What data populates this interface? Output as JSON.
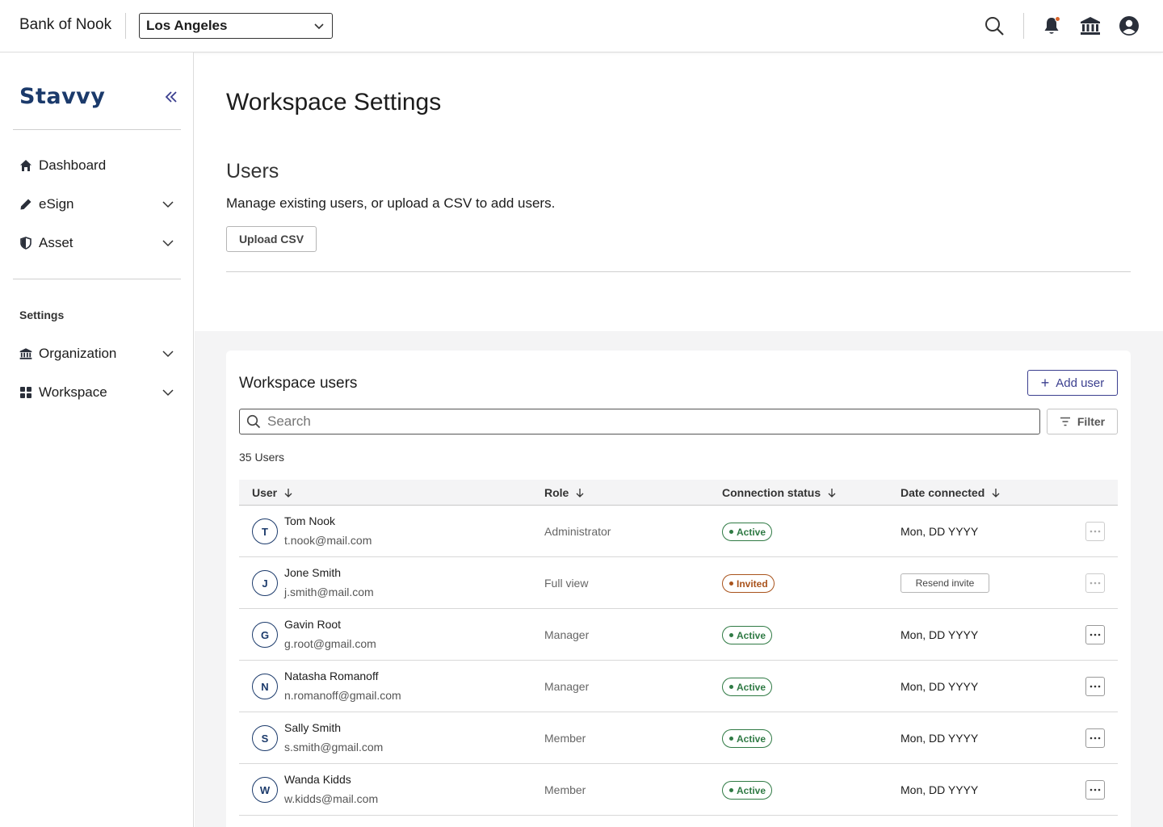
{
  "topbar": {
    "org_name": "Bank of Nook",
    "location": "Los Angeles",
    "icons": [
      "search-icon",
      "bell-icon",
      "bank-icon",
      "account-icon"
    ]
  },
  "sidebar": {
    "brand": "Stavvy",
    "items": [
      {
        "label": "Dashboard",
        "icon": "home-icon"
      },
      {
        "label": "eSign",
        "icon": "pen-icon"
      },
      {
        "label": "Asset",
        "icon": "shield-icon"
      }
    ],
    "settings_label": "Settings",
    "settings_items": [
      {
        "label": "Organization",
        "icon": "bank-icon"
      },
      {
        "label": "Workspace",
        "icon": "grid-icon"
      }
    ]
  },
  "main": {
    "page_title": "Workspace Settings",
    "users_heading": "Users",
    "users_description": "Manage existing users, or upload a CSV to add users.",
    "upload_label": "Upload CSV"
  },
  "card": {
    "title": "Workspace users",
    "add_user_label": "Add user",
    "search_placeholder": "Search",
    "filter_label": "Filter",
    "user_count": "35 Users",
    "columns": [
      "User",
      "Role",
      "Connection status",
      "Date connected"
    ],
    "rows": [
      {
        "initial": "T",
        "name": "Tom Nook",
        "email": "t.nook@mail.com",
        "role": "Administrator",
        "status": "Active",
        "date": "Mon, DD YYYY"
      },
      {
        "initial": "J",
        "name": "Jone Smith",
        "email": "j.smith@mail.com",
        "role": "Full view",
        "status": "Invited",
        "action": "Resend invite"
      },
      {
        "initial": "G",
        "name": "Gavin Root",
        "email": "g.root@gmail.com",
        "role": "Manager",
        "status": "Active",
        "date": "Mon, DD YYYY"
      },
      {
        "initial": "N",
        "name": "Natasha Romanoff",
        "email": "n.romanoff@gmail.com",
        "role": "Manager",
        "status": "Active",
        "date": "Mon, DD YYYY"
      },
      {
        "initial": "S",
        "name": "Sally Smith",
        "email": "s.smith@gmail.com",
        "role": "Member",
        "status": "Active",
        "date": "Mon, DD YYYY"
      },
      {
        "initial": "W",
        "name": "Wanda Kidds",
        "email": "w.kidds@mail.com",
        "role": "Member",
        "status": "Active",
        "date": "Mon, DD YYYY"
      }
    ]
  },
  "colors": {
    "brand": "#1b3a6b",
    "accent": "#3b3f8f",
    "active": "#2f7a44",
    "invited": "#a9531c",
    "notification": "#d9642b"
  }
}
